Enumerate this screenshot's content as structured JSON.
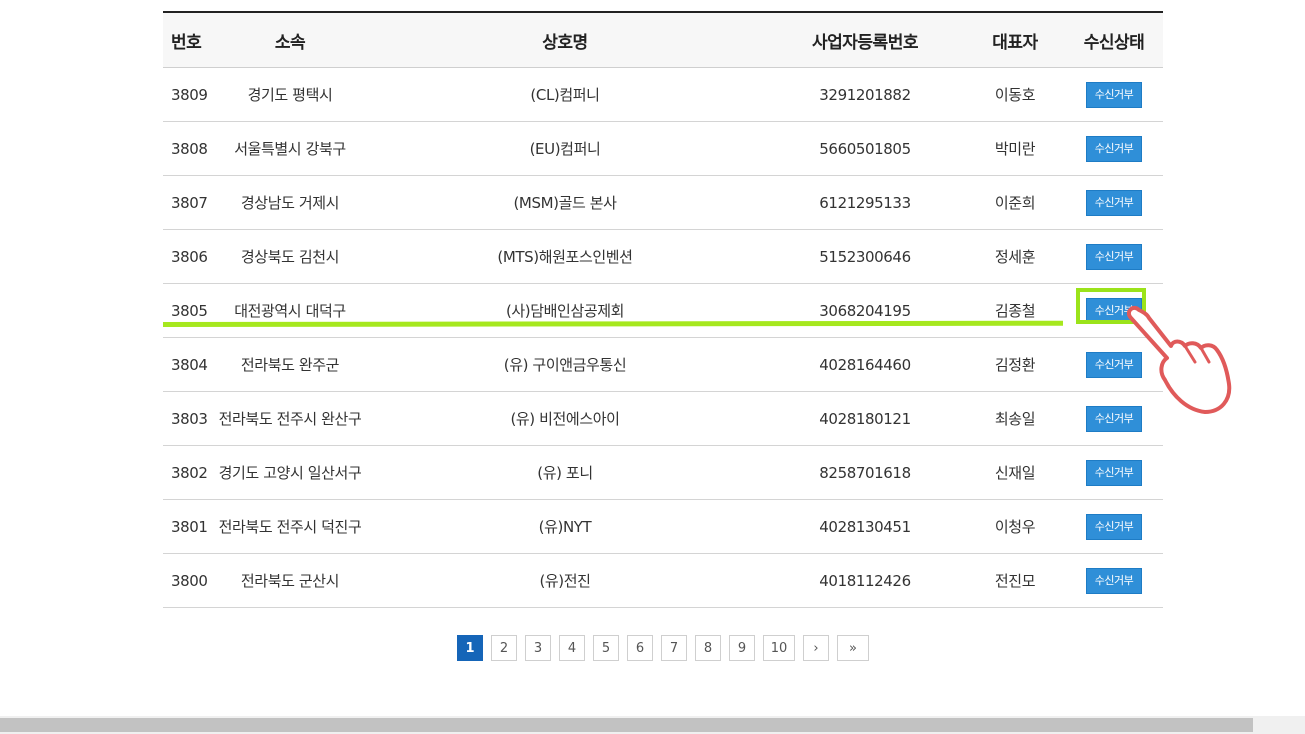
{
  "table": {
    "headers": {
      "no": "번호",
      "affiliation": "소속",
      "company": "상호명",
      "business_no": "사업자등록번호",
      "ceo": "대표자",
      "status": "수신상태"
    },
    "rows": [
      {
        "no": "3809",
        "affiliation": "경기도 평택시",
        "company": "(CL)컴퍼니",
        "business_no": "3291201882",
        "ceo": "이동호",
        "status": "수신거부"
      },
      {
        "no": "3808",
        "affiliation": "서울특별시 강북구",
        "company": "(EU)컴퍼니",
        "business_no": "5660501805",
        "ceo": "박미란",
        "status": "수신거부"
      },
      {
        "no": "3807",
        "affiliation": "경상남도 거제시",
        "company": "(MSM)골드 본사",
        "business_no": "6121295133",
        "ceo": "이준희",
        "status": "수신거부"
      },
      {
        "no": "3806",
        "affiliation": "경상북도 김천시",
        "company": "(MTS)해원포스인벤션",
        "business_no": "5152300646",
        "ceo": "정세훈",
        "status": "수신거부"
      },
      {
        "no": "3805",
        "affiliation": "대전광역시 대덕구",
        "company": "(사)담배인삼공제회",
        "business_no": "3068204195",
        "ceo": "김종철",
        "status": "수신거부"
      },
      {
        "no": "3804",
        "affiliation": "전라북도 완주군",
        "company": "(유) 구이앤금우통신",
        "business_no": "4028164460",
        "ceo": "김정환",
        "status": "수신거부"
      },
      {
        "no": "3803",
        "affiliation": "전라북도 전주시 완산구",
        "company": "(유) 비전에스아이",
        "business_no": "4028180121",
        "ceo": "최송일",
        "status": "수신거부"
      },
      {
        "no": "3802",
        "affiliation": "경기도 고양시 일산서구",
        "company": "(유) 포니",
        "business_no": "8258701618",
        "ceo": "신재일",
        "status": "수신거부"
      },
      {
        "no": "3801",
        "affiliation": "전라북도 전주시 덕진구",
        "company": "(유)NYT",
        "business_no": "4028130451",
        "ceo": "이청우",
        "status": "수신거부"
      },
      {
        "no": "3800",
        "affiliation": "전라북도 군산시",
        "company": "(유)전진",
        "business_no": "4018112426",
        "ceo": "전진모",
        "status": "수신거부"
      }
    ]
  },
  "highlight": {
    "row_no": "3805",
    "color": "#9be31a"
  },
  "pagination": {
    "pages": [
      "1",
      "2",
      "3",
      "4",
      "5",
      "6",
      "7",
      "8",
      "9",
      "10"
    ],
    "current": "1",
    "next_label": "›",
    "last_label": "»"
  },
  "colors": {
    "status_button": "#2f8fd8",
    "active_page": "#1565b8"
  }
}
